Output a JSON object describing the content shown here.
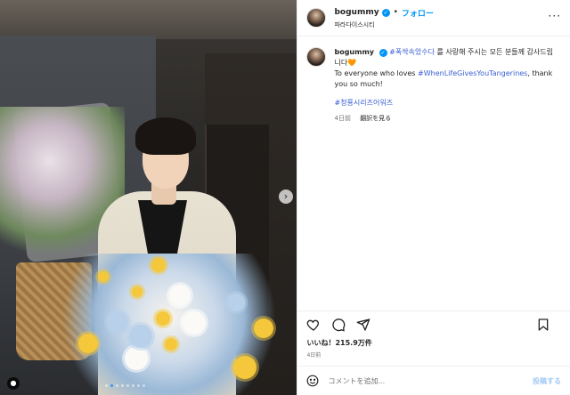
{
  "header": {
    "username": "bogummy",
    "verified_icon": "verified-badge-icon",
    "separator": "•",
    "follow_label": "フォロー",
    "location": "파라다이스시티",
    "more_icon": "more-options-icon"
  },
  "caption": {
    "username": "bogummy",
    "hashtag1": "#폭싹속았수다",
    "text_ko": " 를 사랑해 주시는 모든 분들께 감사드립니다",
    "emoji": "🧡",
    "text_en_before": "To everyone who loves ",
    "hashtag2": "#WhenLifeGivesYouTangerines",
    "text_en_after": ", thank you so much!",
    "hashtag3": "#청룡시리즈어워즈",
    "time": "4日前",
    "translate_label": "翻訳を見る"
  },
  "actions": {
    "like_icon": "heart-icon",
    "comment_icon": "comment-icon",
    "share_icon": "share-icon",
    "save_icon": "bookmark-icon"
  },
  "likes": {
    "text": "いいね！215.9万件"
  },
  "post_date": "4日前",
  "comment": {
    "placeholder": "コメントを追加...",
    "post_label": "投稿する",
    "emoji_icon": "emoji-icon"
  },
  "carousel": {
    "next_icon": "chevron-right-icon",
    "slide_count": 8,
    "active_index": 1
  },
  "colors": {
    "link": "#0095f6",
    "hashtag": "#3b5fd1",
    "secondary_text": "#737373"
  }
}
